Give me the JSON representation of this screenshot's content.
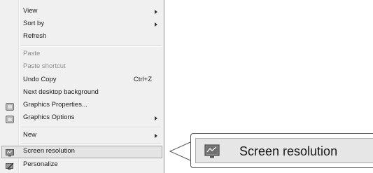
{
  "menu": {
    "items": [
      {
        "label": "View",
        "has_submenu": true
      },
      {
        "label": "Sort by",
        "has_submenu": true
      },
      {
        "label": "Refresh"
      },
      {
        "label": "Paste",
        "disabled": true
      },
      {
        "label": "Paste shortcut",
        "disabled": true
      },
      {
        "label": "Undo Copy",
        "shortcut": "Ctrl+Z"
      },
      {
        "label": "Next desktop background"
      },
      {
        "label": "Graphics Properties...",
        "icon": "graphics-properties-icon"
      },
      {
        "label": "Graphics Options",
        "icon": "graphics-options-icon",
        "has_submenu": true
      },
      {
        "label": "New",
        "has_submenu": true
      },
      {
        "label": "Screen resolution",
        "icon": "screen-resolution-icon",
        "highlighted": true
      },
      {
        "label": "Personalize",
        "icon": "personalize-icon"
      }
    ]
  },
  "callout": {
    "label": "Screen resolution",
    "icon": "screen-resolution-icon"
  }
}
